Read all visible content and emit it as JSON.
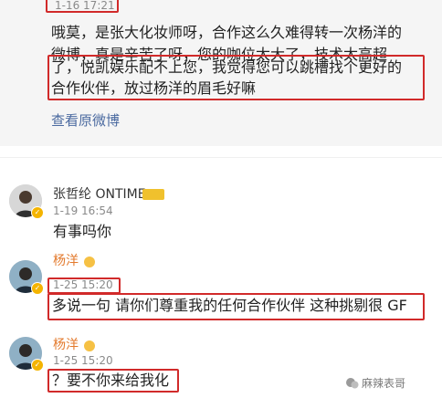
{
  "post": {
    "timestamp": "1-16 17:21",
    "text_lines": [
      "哦莫，是张大化妆师呀，合作这么久难得转一次杨洋的",
      "微博，真是辛苦了呀，您的咖位太大了，技术太高超",
      "了，悦凯娱乐配不上您，我觉得您可以跳槽找个更好的",
      "合作伙伴，放过杨洋的眉毛好嘛"
    ],
    "view_original_label": "查看原微博"
  },
  "comments": [
    {
      "name": "张哲纶 ONTIME",
      "tag_label": "",
      "time": "1-19 16:54",
      "text": "有事吗你"
    },
    {
      "name": "杨洋",
      "time": "1-25 15:20",
      "text": "多说一句 请你们尊重我的任何合作伙伴 这种挑剔很 GF"
    },
    {
      "name": "杨洋",
      "time": "1-25 15:20",
      "text": "？要不你来给我化"
    }
  ],
  "watermark": "麻辣表哥",
  "colors": {
    "highlight_box": "#d12a2a",
    "link": "#4b6aa0",
    "vip_name": "#e37a2d",
    "timestamp": "#8a8a8a"
  },
  "icons": {
    "comment_avatar_1": "user-avatar-icon",
    "comment_avatar_2": "user-avatar-icon",
    "comment_avatar_3": "user-avatar-icon",
    "verified_badge": "verified-badge-icon",
    "watermark_logo": "wechat-logo-icon"
  }
}
